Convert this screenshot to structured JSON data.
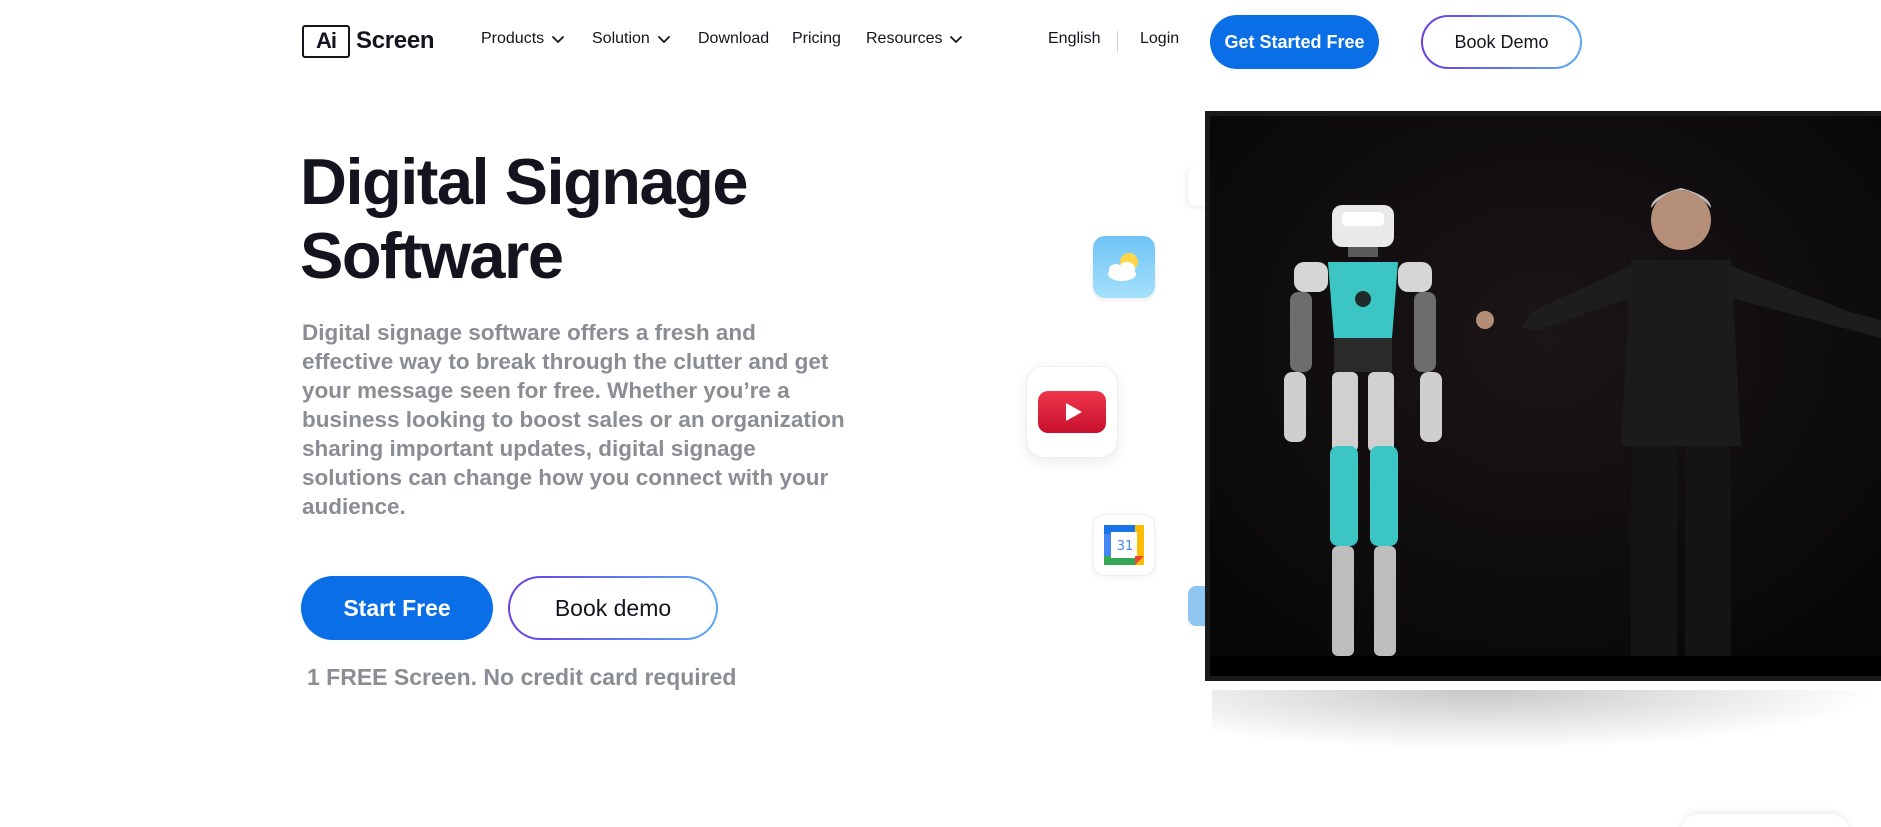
{
  "brand": {
    "logo_mark": "Ai",
    "logo_text": "Screen"
  },
  "nav": {
    "products": "Products",
    "solution": "Solution",
    "download": "Download",
    "pricing": "Pricing",
    "resources": "Resources",
    "language": "English",
    "login": "Login"
  },
  "header_buttons": {
    "get_started": "Get Started Free",
    "book_demo": "Book Demo"
  },
  "hero": {
    "title_line1": "Digital Signage",
    "title_line2": "Software",
    "description": "Digital signage software offers a fresh and effective way to break through the clutter and get your message seen for free. Whether you’re a business looking to boost sales or an organization sharing important updates, digital signage solutions can change how you connect with your audience.",
    "start_button": "Start Free",
    "demo_button": "Book demo",
    "note": "1 FREE Screen. No credit card required"
  },
  "app_icons": {
    "weather": "weather-icon",
    "youtube": "youtube-icon",
    "calendar": "calendar-icon",
    "calendar_day": "31"
  },
  "colors": {
    "primary": "#0a6fe6",
    "text": "#14141f",
    "muted": "#8a8d94",
    "gradient_start": "#6a3de8",
    "gradient_end": "#5aa9f5"
  }
}
